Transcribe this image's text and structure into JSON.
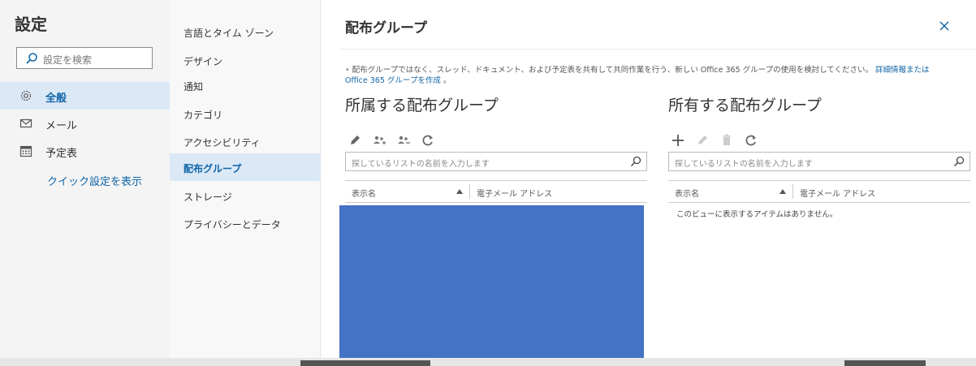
{
  "left": {
    "title": "設定",
    "search_placeholder": "設定を検索",
    "nav": [
      {
        "label": "全般",
        "icon": "gear-icon",
        "active": true
      },
      {
        "label": "メール",
        "icon": "mail-icon",
        "active": false
      },
      {
        "label": "予定表",
        "icon": "calendar-icon",
        "active": false
      }
    ],
    "quick_settings": "クイック設定を表示"
  },
  "middle": {
    "items": [
      {
        "label": "言語とタイム ゾーン"
      },
      {
        "label": "デザイン"
      },
      {
        "label": "通知"
      },
      {
        "label": "カテゴリ"
      },
      {
        "label": "アクセシビリティ"
      },
      {
        "label": "配布グループ",
        "active": true
      },
      {
        "label": "ストレージ"
      },
      {
        "label": "プライバシーとデータ"
      }
    ]
  },
  "content": {
    "title": "配布グループ",
    "notice_bullet": "•",
    "notice_text": "配布グループではなく、スレッド、ドキュメント、および予定表を共有して共同作業を行う、新しい Office 365 グループの使用を検討してください。",
    "notice_link1": "詳細情報または",
    "notice_link2": "Office 365 グループを作成",
    "notice_end": "。",
    "member_section": {
      "title": "所属する配布グループ",
      "search_placeholder": "探しているリストの名前を入力します",
      "col_display_name": "表示名",
      "col_email": "電子メール アドレス"
    },
    "owner_section": {
      "title": "所有する配布グループ",
      "search_placeholder": "探しているリストの名前を入力します",
      "col_display_name": "表示名",
      "col_email": "電子メール アドレス",
      "empty_message": "このビューに表示するアイテムはありません。"
    }
  },
  "colors": {
    "accent": "#0f64a6",
    "active_bg": "#dbe8f6",
    "redaction": "#4472c4"
  }
}
